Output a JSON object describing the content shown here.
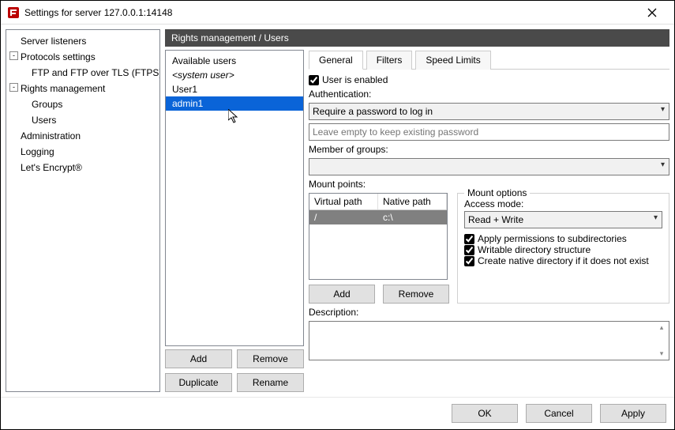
{
  "window": {
    "title": "Settings for server 127.0.0.1:14148"
  },
  "sidebar": {
    "items": [
      {
        "label": "Server listeners"
      },
      {
        "label": "Protocols settings"
      },
      {
        "label": "FTP and FTP over TLS (FTPS)"
      },
      {
        "label": "Rights management"
      },
      {
        "label": "Groups"
      },
      {
        "label": "Users"
      },
      {
        "label": "Administration"
      },
      {
        "label": "Logging"
      },
      {
        "label": "Let's Encrypt®"
      }
    ]
  },
  "header": {
    "breadcrumb": "Rights management / Users"
  },
  "users_panel": {
    "label": "Available users",
    "items": [
      {
        "label": "<system user>"
      },
      {
        "label": "User1"
      },
      {
        "label": "admin1"
      }
    ],
    "buttons": {
      "add": "Add",
      "remove": "Remove",
      "duplicate": "Duplicate",
      "rename": "Rename"
    }
  },
  "tabs": {
    "general": "General",
    "filters": "Filters",
    "speed": "Speed Limits"
  },
  "general": {
    "enabled_label": "User is enabled",
    "auth_label": "Authentication:",
    "auth_mode": "Require a password to log in",
    "password_placeholder": "Leave empty to keep existing password",
    "member_label": "Member of groups:",
    "member_value": "",
    "mount_label": "Mount points:",
    "mp_headers": {
      "virtual": "Virtual path",
      "native": "Native path"
    },
    "mp_row": {
      "virtual": "/",
      "native": "c:\\"
    },
    "mount_options_legend": "Mount options",
    "access_label": "Access mode:",
    "access_value": "Read + Write",
    "perm_sub": "Apply permissions to subdirectories",
    "writable": "Writable directory structure",
    "create_native": "Create native directory if it does not exist",
    "mp_add": "Add",
    "mp_remove": "Remove",
    "desc_label": "Description:"
  },
  "footer": {
    "ok": "OK",
    "cancel": "Cancel",
    "apply": "Apply"
  }
}
